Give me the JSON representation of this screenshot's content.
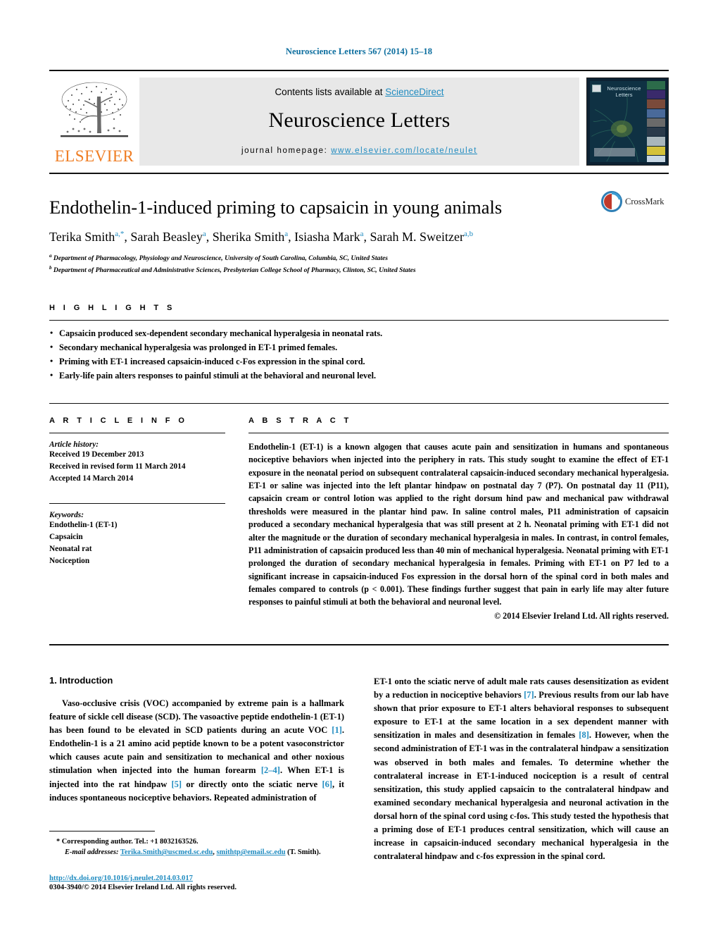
{
  "running_head": "Neuroscience Letters 567 (2014) 15–18",
  "masthead": {
    "publisher_logo_text": "ELSEVIER",
    "contents_prefix": "Contents lists available at ",
    "contents_link": "ScienceDirect",
    "journal_name": "Neuroscience Letters",
    "homepage_prefix": "journal homepage: ",
    "homepage_url": "www.elsevier.com/locate/neulet",
    "cover_title": "Neuroscience Letters",
    "accent_color": "#1f8bc0",
    "elsevier_orange": "#ef7d23"
  },
  "article": {
    "title": "Endothelin-1-induced priming to capsaicin in young animals",
    "authors": [
      {
        "name": "Terika Smith",
        "sup": "a,*"
      },
      {
        "name": "Sarah Beasley",
        "sup": "a"
      },
      {
        "name": "Sherika Smith",
        "sup": "a"
      },
      {
        "name": "Isiasha Mark",
        "sup": "a"
      },
      {
        "name": "Sarah M. Sweitzer",
        "sup": "a,b"
      }
    ],
    "affiliations": [
      {
        "marker": "a",
        "text": "Department of Pharmacology, Physiology and Neuroscience, University of South Carolina, Columbia, SC, United States"
      },
      {
        "marker": "b",
        "text": "Department of Pharmaceutical and Administrative Sciences, Presbyterian College School of Pharmacy, Clinton, SC, United States"
      }
    ],
    "crossmark_label": "CrossMark"
  },
  "highlights": {
    "heading": "H I G H L I G H T S",
    "items": [
      "Capsaicin produced sex-dependent secondary mechanical hyperalgesia in neonatal rats.",
      "Secondary mechanical hyperalgesia was prolonged in ET-1 primed females.",
      "Priming with ET-1 increased capsaicin-induced c-Fos expression in the spinal cord.",
      "Early-life pain alters responses to painful stimuli at the behavioral and neuronal level."
    ]
  },
  "article_info": {
    "heading": "A R T I C L E    I N F O",
    "history_label": "Article history:",
    "history": [
      "Received 19 December 2013",
      "Received in revised form 11 March 2014",
      "Accepted 14 March 2014"
    ],
    "keywords_label": "Keywords:",
    "keywords": [
      "Endothelin-1 (ET-1)",
      "Capsaicin",
      "Neonatal rat",
      "Nociception"
    ]
  },
  "abstract": {
    "heading": "A B S T R A C T",
    "text": "Endothelin-1 (ET-1) is a known algogen that causes acute pain and sensitization in humans and spontaneous nociceptive behaviors when injected into the periphery in rats. This study sought to examine the effect of ET-1 exposure in the neonatal period on subsequent contralateral capsaicin-induced secondary mechanical hyperalgesia. ET-1 or saline was injected into the left plantar hindpaw on postnatal day 7 (P7). On postnatal day 11 (P11), capsaicin cream or control lotion was applied to the right dorsum hind paw and mechanical paw withdrawal thresholds were measured in the plantar hind paw. In saline control males, P11 administration of capsaicin produced a secondary mechanical hyperalgesia that was still present at 2 h. Neonatal priming with ET-1 did not alter the magnitude or the duration of secondary mechanical hyperalgesia in males. In contrast, in control females, P11 administration of capsaicin produced less than 40 min of mechanical hyperalgesia. Neonatal priming with ET-1 prolonged the duration of secondary mechanical hyperalgesia in females. Priming with ET-1 on P7 led to a significant increase in capsaicin-induced Fos expression in the dorsal horn of the spinal cord in both males and females compared to controls (p < 0.001). These findings further suggest that pain in early life may alter future responses to painful stimuli at both the behavioral and neuronal level.",
    "copyright": "© 2014 Elsevier Ireland Ltd. All rights reserved."
  },
  "introduction": {
    "section_number": "1.",
    "section_title": "Introduction",
    "left_paragraph_part1": "Vaso-occlusive crisis (VOC) accompanied by extreme pain is a hallmark feature of sickle cell disease (SCD). The vasoactive peptide endothelin-1 (ET-1) has been found to be elevated in SCD patients during an acute VOC ",
    "ref1": "[1]",
    "left_paragraph_part2": ". Endothelin-1 is a 21 amino acid peptide known to be a potent vasoconstrictor which causes acute pain and sensitization to mechanical and other noxious stimulation when injected into the human forearm ",
    "ref2": "[2–4]",
    "left_paragraph_part3": ". When ET-1 is injected into the rat hindpaw ",
    "ref3": "[5]",
    "left_paragraph_part4": " or directly onto the sciatic nerve ",
    "ref4": "[6]",
    "left_paragraph_part5": ", it induces spontaneous nociceptive behaviors. Repeated administration of",
    "right_paragraph_part1": "ET-1 onto the sciatic nerve of adult male rats causes desensitization as evident by a reduction in nociceptive behaviors ",
    "ref5": "[7]",
    "right_paragraph_part2": ". Previous results from our lab have shown that prior exposure to ET-1 alters behavioral responses to subsequent exposure to ET-1 at the same location in a sex dependent manner with sensitization in males and desensitization in females ",
    "ref6": "[8]",
    "right_paragraph_part3": ". However, when the second administration of ET-1 was in the contralateral hindpaw a sensitization was observed in both males and females. To determine whether the contralateral increase in ET-1-induced nociception is a result of central sensitization, this study applied capsaicin to the contralateral hindpaw and examined secondary mechanical hyperalgesia and neuronal activation in the dorsal horn of the spinal cord using c-fos. This study tested the hypothesis that a priming dose of ET-1 produces central sensitization, which will cause an increase in capsaicin-induced secondary mechanical hyperalgesia in the contralateral hindpaw and c-fos expression in the spinal cord."
  },
  "footnotes": {
    "corresponding_marker": "*",
    "corresponding_text": " Corresponding author. Tel.: +1 8032163526.",
    "email_label": "E-mail addresses:",
    "email1": "Terika.Smith@uscmed.sc.edu",
    "email_sep": ",",
    "email2": "smithtp@email.sc.edu",
    "email_suffix": " (T. Smith).",
    "doi": "http://dx.doi.org/10.1016/j.neulet.2014.03.017",
    "issn_line": "0304-3940/© 2014 Elsevier Ireland Ltd. All rights reserved."
  }
}
